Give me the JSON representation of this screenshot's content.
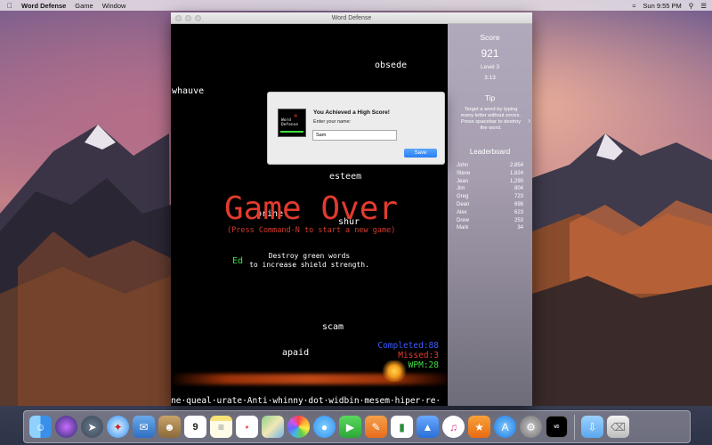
{
  "menubar": {
    "app_name": "Word Defense",
    "menus": [
      "Game",
      "Window"
    ],
    "clock": "Sun 9:55 PM"
  },
  "window": {
    "title": "Word Defense"
  },
  "game": {
    "words": [
      "obsede",
      "whauve",
      "esteem",
      "brine",
      "shur",
      "Ed",
      "scam",
      "apaid"
    ],
    "game_over_title": "Game Over",
    "game_over_sub": "(Press Command-N to start a new game)",
    "tip_line1": "Destroy green words",
    "tip_line2": "to increase shield strength.",
    "completed": "Completed:88",
    "missed": "Missed:3",
    "wpm": "WPM:28",
    "ticker": "ne·queal·urate·Anti·whinny·dot·widbin·mesem·hiper·re·"
  },
  "sidebar": {
    "score_title": "Score",
    "score": "921",
    "level": "Level 3",
    "time": "3:13",
    "tip_title": "Tip",
    "tip_text": "Target a word by typing every letter without errors. Press spacebar to destroy the word.",
    "leaderboard_title": "Leaderboard",
    "leaderboard": [
      {
        "name": "John",
        "score": "2,854"
      },
      {
        "name": "Steve",
        "score": "1,824"
      },
      {
        "name": "Jean",
        "score": "1,290"
      },
      {
        "name": "Jim",
        "score": "804"
      },
      {
        "name": "Greg",
        "score": "723"
      },
      {
        "name": "Dean",
        "score": "698"
      },
      {
        "name": "Alex",
        "score": "623"
      },
      {
        "name": "Drew",
        "score": "253"
      },
      {
        "name": "Mark",
        "score": "34"
      }
    ]
  },
  "dialog": {
    "title": "You Achieved a High Score!",
    "label": "Enter your name:",
    "input_value": "Sam",
    "save_label": "Save",
    "icon_text": "Word Defense"
  },
  "colors": {
    "game_over_red": "#e23b2e",
    "completed_blue": "#3b5bff",
    "missed_red": "#e23b2e",
    "wpm_green": "#3fe03f",
    "save_button_blue": "#2a7ef2"
  },
  "dock": {
    "icons": [
      "finder-icon",
      "siri-icon",
      "launchpad-icon",
      "safari-icon",
      "mail-icon",
      "contacts-icon",
      "calendar-icon",
      "notes-icon",
      "reminders-icon",
      "maps-icon",
      "photos-icon",
      "messages-icon",
      "facetime-icon",
      "pages-icon",
      "numbers-icon",
      "keynote-icon",
      "itunes-icon",
      "ibooks-icon",
      "app-store-icon",
      "system-preferences-icon",
      "word-defense-icon",
      "downloads-icon",
      "trash-icon"
    ],
    "calendar_day": "9"
  }
}
